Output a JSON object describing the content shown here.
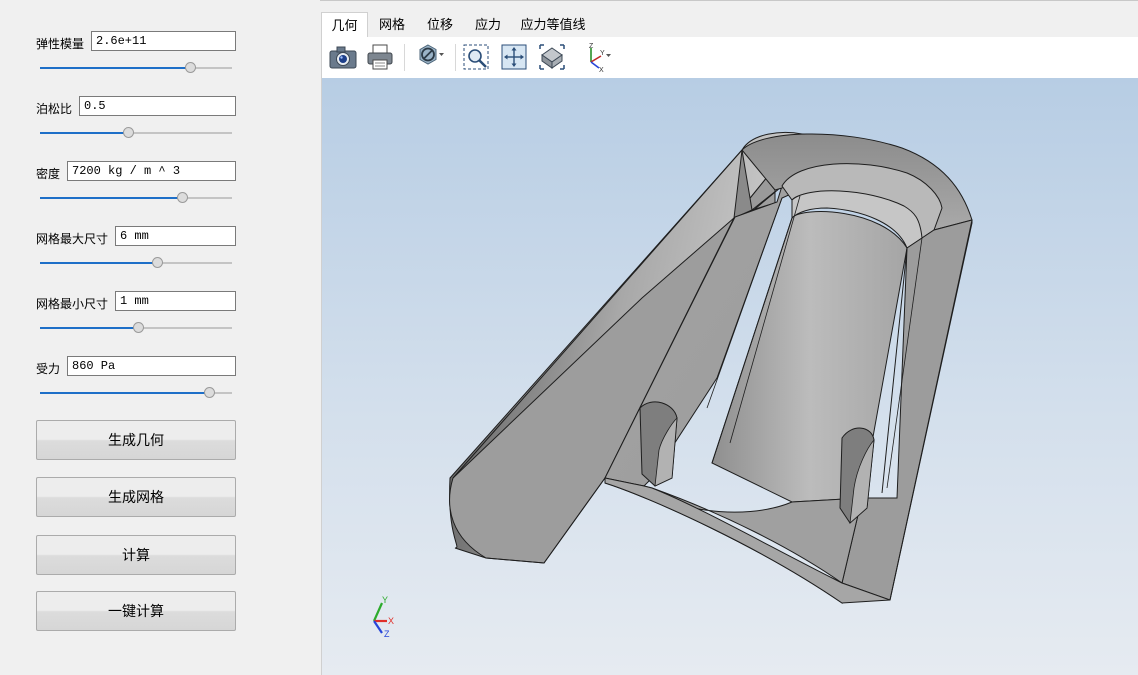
{
  "params": [
    {
      "label": "弹性模量",
      "value": "2.6e+11",
      "slider_fraction": 0.78
    },
    {
      "label": "泊松比",
      "value": "0.5",
      "slider_fraction": 0.46
    },
    {
      "label": "密度",
      "value": "7200 kg / m ^ 3",
      "slider_fraction": 0.74
    },
    {
      "label": "网格最大尺寸",
      "value": "6 mm",
      "slider_fraction": 0.61
    },
    {
      "label": "网格最小尺寸",
      "value": "1 mm",
      "slider_fraction": 0.51
    },
    {
      "label": "受力",
      "value": "860 Pa",
      "slider_fraction": 0.88
    }
  ],
  "buttons": {
    "generate_geometry": "生成几何",
    "generate_mesh": "生成网格",
    "compute": "计算",
    "one_click_compute": "一键计算"
  },
  "tabs": [
    {
      "label": "几何",
      "active": true
    },
    {
      "label": "网格",
      "active": false
    },
    {
      "label": "位移",
      "active": false
    },
    {
      "label": "应力",
      "active": false
    },
    {
      "label": "应力等值线",
      "active": false
    }
  ],
  "toolbar": [
    "camera-icon",
    "print-icon",
    "clip-plane-icon",
    "zoom-box-icon",
    "fit-all-icon",
    "iso-view-icon",
    "axes-view-icon"
  ],
  "triad": {
    "y": "Y",
    "x": "X",
    "z": "Z"
  },
  "colors": {
    "accent": "#1e6fc8",
    "axis_x": "#e0302a",
    "axis_y": "#2cab2c",
    "axis_z": "#2846d8",
    "model_gray": "#a8a8a8"
  }
}
